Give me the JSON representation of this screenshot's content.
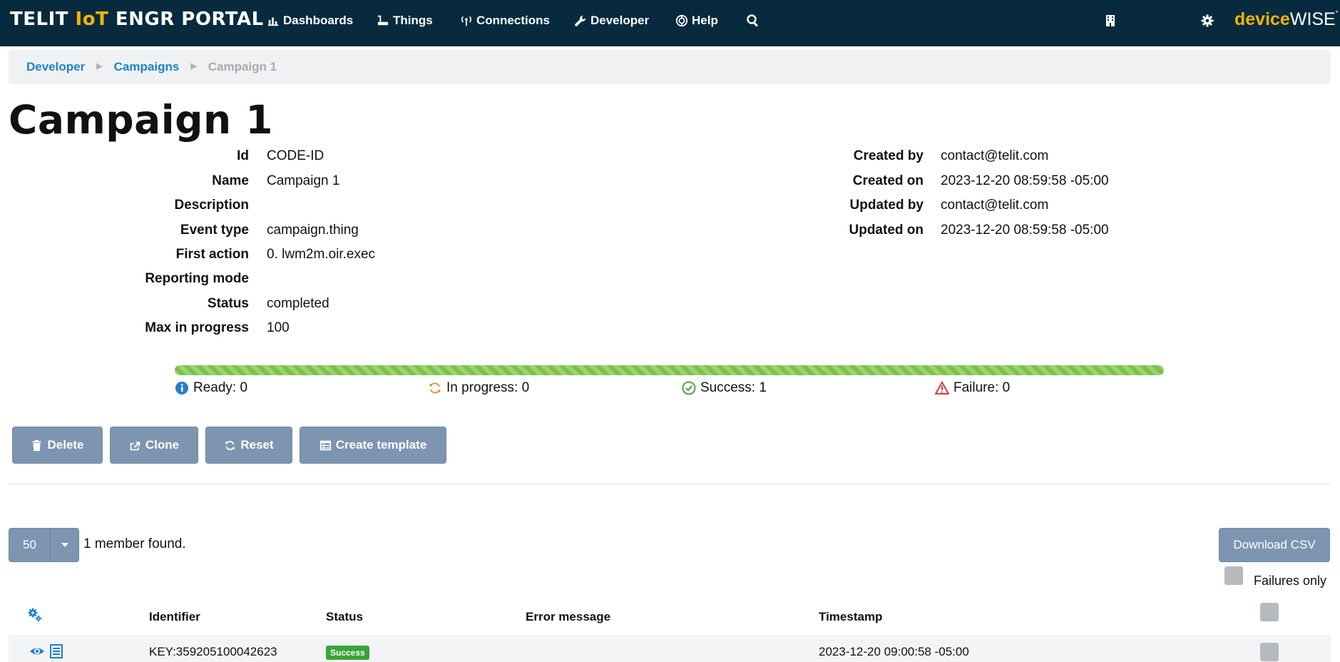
{
  "navbar": {
    "brand_left": "TELIT ",
    "brand_accent": "IoT",
    "brand_right": " ENGR PORTAL",
    "items": [
      {
        "label": "Dashboards",
        "icon": "bar-chart-icon"
      },
      {
        "label": "Things",
        "icon": "router-icon"
      },
      {
        "label": "Connections",
        "icon": "antenna-icon"
      },
      {
        "label": "Developer",
        "icon": "wrench-icon"
      },
      {
        "label": "Help",
        "icon": "lifebuoy-icon"
      }
    ],
    "search_icon": "search-icon",
    "building_icon": "building-icon",
    "settings_icon": "gear-icon",
    "logo_dev": "device",
    "logo_wise": "WISE",
    "logo_mark": "°"
  },
  "breadcrumb": {
    "items": [
      "Developer",
      "Campaigns"
    ],
    "current": "Campaign 1"
  },
  "page": {
    "title": "Campaign 1"
  },
  "details_left": [
    {
      "label": "Id",
      "value": "CODE-ID"
    },
    {
      "label": "Name",
      "value": "Campaign 1"
    },
    {
      "label": "Description",
      "value": ""
    },
    {
      "label": "Event type",
      "value": "campaign.thing"
    },
    {
      "label": "First action",
      "value": "0. lwm2m.oir.exec"
    },
    {
      "label": "Reporting mode",
      "value": ""
    },
    {
      "label": "Status",
      "value": "completed"
    },
    {
      "label": "Max in progress",
      "value": "100"
    }
  ],
  "details_right": [
    {
      "label": "Created by",
      "value": "contact@telit.com"
    },
    {
      "label": "Created on",
      "value": "2023-12-20 08:59:58 -05:00"
    },
    {
      "label": "Updated by",
      "value": "contact@telit.com"
    },
    {
      "label": "Updated on",
      "value": "2023-12-20 08:59:58 -05:00"
    }
  ],
  "progress": {
    "success_fraction": 1.0,
    "color": "#7cc247",
    "legend": [
      {
        "label": "Ready: 0",
        "icon": "info-icon",
        "color": "#2a7bc9"
      },
      {
        "label": "In progress: 0",
        "icon": "refresh-icon",
        "color": "#e8903a"
      },
      {
        "label": "Success: 1",
        "icon": "check-circle-icon",
        "color": "#4aa83a"
      },
      {
        "label": "Failure: 0",
        "icon": "warning-icon",
        "color": "#d23b3b"
      }
    ]
  },
  "actions": {
    "delete": "Delete",
    "clone": "Clone",
    "reset": "Reset",
    "create_template": "Create template"
  },
  "members": {
    "page_size": "50",
    "found_text": "1 member found.",
    "download_csv": "Download CSV",
    "failures_only": "Failures only"
  },
  "table": {
    "settings_icon": "cogs-icon",
    "columns": [
      "Identifier",
      "Status",
      "Error message",
      "Timestamp"
    ],
    "rows": [
      {
        "identifier": "KEY:359205100042623",
        "status": "Success",
        "error_message": "",
        "timestamp": "2023-12-20 09:00:58 -05:00"
      }
    ]
  },
  "colors": {
    "navbar_bg": "#072a3e",
    "accent_yellow": "#f5b400",
    "link_blue": "#1d83c6",
    "button_bg": "#7d95b1",
    "success_green": "#3aa33a"
  }
}
